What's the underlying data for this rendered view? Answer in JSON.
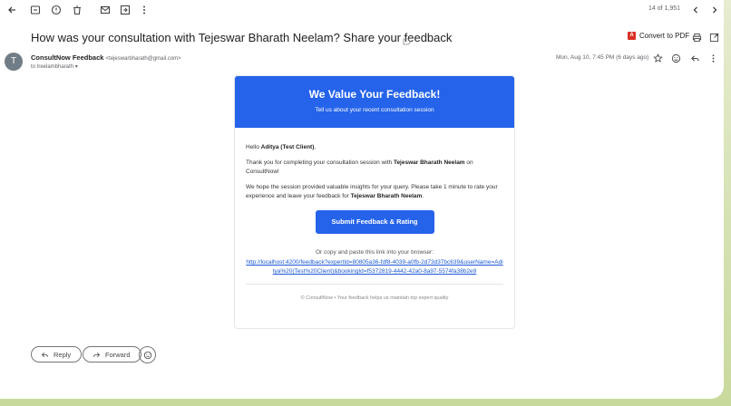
{
  "toolbar": {
    "icons": [
      "back-arrow-icon",
      "archive-icon",
      "report-spam-icon",
      "delete-icon",
      "mark-unread-icon",
      "move-to-icon",
      "more-vertical-icon"
    ],
    "pager": "14 of 1,951"
  },
  "email": {
    "subject": "How was your consultation with Tejeswar Bharath Neelam? Share your feedback",
    "convert_pdf": "Convert to PDF",
    "sender_initial": "T",
    "sender_name": "ConsultNow Feedback",
    "sender_email": "<tejeswarbharath@gmail.com>",
    "to_line": "to treelambharath",
    "date": "Mon, Aug 10, 7:45 PM (6 days ago)"
  },
  "message": {
    "banner_title": "We Value Your Feedback!",
    "banner_subtitle": "Tell us about your recent consultation session",
    "greeting_prefix": "Hello ",
    "client_name": "Aditya (Test Client)",
    "greeting_suffix": ",",
    "thanks_prefix": "Thank you for completing your consultation session with ",
    "expert_name": "Tejeswar Bharath Neelam",
    "thanks_suffix": " on ConsultNow!",
    "hope_text": "We hope the session provided valuable insights for your query. Please take 1 minute to rate your experience and leave your feedback for ",
    "hope_suffix": ".",
    "cta_label": "Submit Feedback & Rating",
    "copy_label": "Or copy and paste this link into your browser:",
    "link": "http://localhost:4200/feedback?expertId=80805a36-fdf8-4039-a0fb-2d73d37bc639&userName=Aditya%20(Test%20Client)&bookingId=f5372819-4442-42a0-8a97-5574fa38b2e9",
    "footer": "© ConsultNow • Your feedback helps us maintain top expert quality"
  },
  "actions": {
    "reply": "Reply",
    "forward": "Forward"
  },
  "colors": {
    "accent": "#2563eb",
    "link": "#1a57d6",
    "pdf_red": "#d93025"
  }
}
